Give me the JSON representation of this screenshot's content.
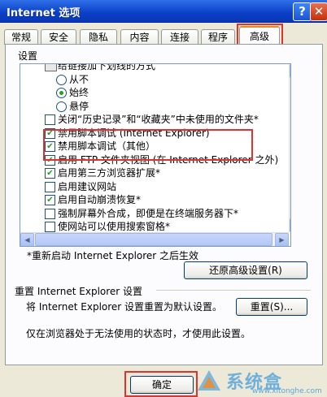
{
  "window": {
    "title": "Internet 选项",
    "help_glyph": "?",
    "close_glyph": "✕"
  },
  "tabs": [
    "常规",
    "安全",
    "隐私",
    "内容",
    "连接",
    "程序",
    "高级"
  ],
  "active_tab": "高级",
  "settings": {
    "group_label": "设置",
    "items": [
      {
        "type": "folder",
        "label": "给链接加下划线的方式"
      },
      {
        "type": "radio",
        "label": "从不",
        "selected": false
      },
      {
        "type": "radio",
        "label": "始终",
        "selected": true
      },
      {
        "type": "radio",
        "label": "悬停",
        "selected": false
      },
      {
        "type": "checkbox",
        "label": "关闭“历史记录”和“收藏夹”中未使用的文件夹*",
        "checked": false
      },
      {
        "type": "checkbox",
        "label": "禁用脚本调试 (Internet Explorer)",
        "checked": true
      },
      {
        "type": "checkbox",
        "label": "禁用脚本调试（其他）",
        "checked": true
      },
      {
        "type": "checkbox",
        "label": "启用 FTP 文件夹视图 (在 Internet Explorer 之外)",
        "checked": true
      },
      {
        "type": "checkbox",
        "label": "启用第三方浏览器扩展*",
        "checked": true
      },
      {
        "type": "checkbox",
        "label": "启用建议网站",
        "checked": false
      },
      {
        "type": "checkbox",
        "label": "启用自动崩溃恢复*",
        "checked": true
      },
      {
        "type": "checkbox",
        "label": "强制屏幕外合成，即便是在终端服务器下*",
        "checked": false
      },
      {
        "type": "checkbox",
        "label": "使网站可以使用搜索窗格*",
        "checked": false
      }
    ],
    "footnote": "*重新启动 Internet Explorer 之后生效",
    "restore_button": "还原高级设置(R)"
  },
  "reset": {
    "group_label": "重置 Internet Explorer 设置",
    "description": "将 Internet Explorer 设置重置为默认设置。",
    "reset_button": "重置(S)...",
    "note": "仅在浏览器处于无法使用的状态时，才使用此设置。"
  },
  "footer": {
    "ok_button": "确定"
  },
  "watermark": {
    "brand": "系统盒",
    "url": "www.xitonghe.com"
  },
  "colors": {
    "highlight": "#e0332e",
    "check": "#21a121",
    "titlebar": "#0a3fc6"
  }
}
